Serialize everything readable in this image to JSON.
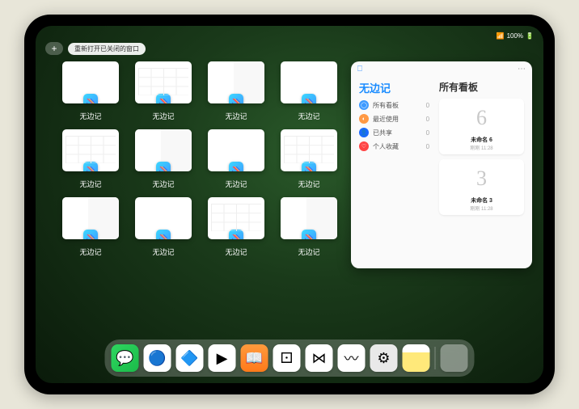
{
  "status": {
    "signal_label": "signal",
    "battery_pct": "100%"
  },
  "controls": {
    "plus_label": "+",
    "reopen_label": "重新打开已关闭的窗口"
  },
  "app_name": "无边记",
  "thumbnails": [
    {
      "label": "无边记",
      "style": "blank"
    },
    {
      "label": "无边记",
      "style": "grid"
    },
    {
      "label": "无边记",
      "style": "split"
    },
    {
      "label": "无边记",
      "style": "blank"
    },
    {
      "label": "无边记",
      "style": "grid"
    },
    {
      "label": "无边记",
      "style": "split"
    },
    {
      "label": "无边记",
      "style": "blank"
    },
    {
      "label": "无边记",
      "style": "grid"
    },
    {
      "label": "无边记",
      "style": "split"
    },
    {
      "label": "无边记",
      "style": "blank"
    },
    {
      "label": "无边记",
      "style": "grid"
    },
    {
      "label": "无边记",
      "style": "split"
    }
  ],
  "detail": {
    "left_title": "无边记",
    "right_title": "所有看板",
    "menu": [
      {
        "icon_color": "ic-blue",
        "glyph": "◯",
        "label": "所有看板",
        "count": "0"
      },
      {
        "icon_color": "ic-orange",
        "glyph": "◐",
        "label": "最近使用",
        "count": "0"
      },
      {
        "icon_color": "ic-dblue",
        "glyph": "👤",
        "label": "已共享",
        "count": "0"
      },
      {
        "icon_color": "ic-red",
        "glyph": "♡",
        "label": "个人收藏",
        "count": "0"
      }
    ],
    "boards": [
      {
        "sketch": "6",
        "name": "未命名 6",
        "sub": "刚刚 11:28"
      },
      {
        "sketch": "3",
        "name": "未命名 3",
        "sub": "刚刚 11:28"
      }
    ],
    "topbar_icon": "⎕",
    "topbar_more": "⋯"
  },
  "dock": [
    {
      "name": "wechat",
      "bg": "linear-gradient(135deg,#2ed65f,#1bbb4a)",
      "glyph": "💬"
    },
    {
      "name": "app-blue1",
      "bg": "#fff",
      "glyph": "🔵"
    },
    {
      "name": "app-blue2",
      "bg": "#fff",
      "glyph": "🔷"
    },
    {
      "name": "colorplay",
      "bg": "#fff",
      "glyph": "▶"
    },
    {
      "name": "books",
      "bg": "linear-gradient(#ff9a3d,#ff7a1a)",
      "glyph": "📖"
    },
    {
      "name": "dice",
      "bg": "#fff",
      "glyph": "⚀"
    },
    {
      "name": "connector",
      "bg": "#fff",
      "glyph": "⋈"
    },
    {
      "name": "freeform",
      "bg": "#fff",
      "glyph": "〰"
    },
    {
      "name": "settings",
      "bg": "#e9e9e9",
      "glyph": "⚙"
    },
    {
      "name": "notes",
      "bg": "linear-gradient(#fff,#fff 30%,#ffe97a 30%)",
      "glyph": ""
    }
  ]
}
